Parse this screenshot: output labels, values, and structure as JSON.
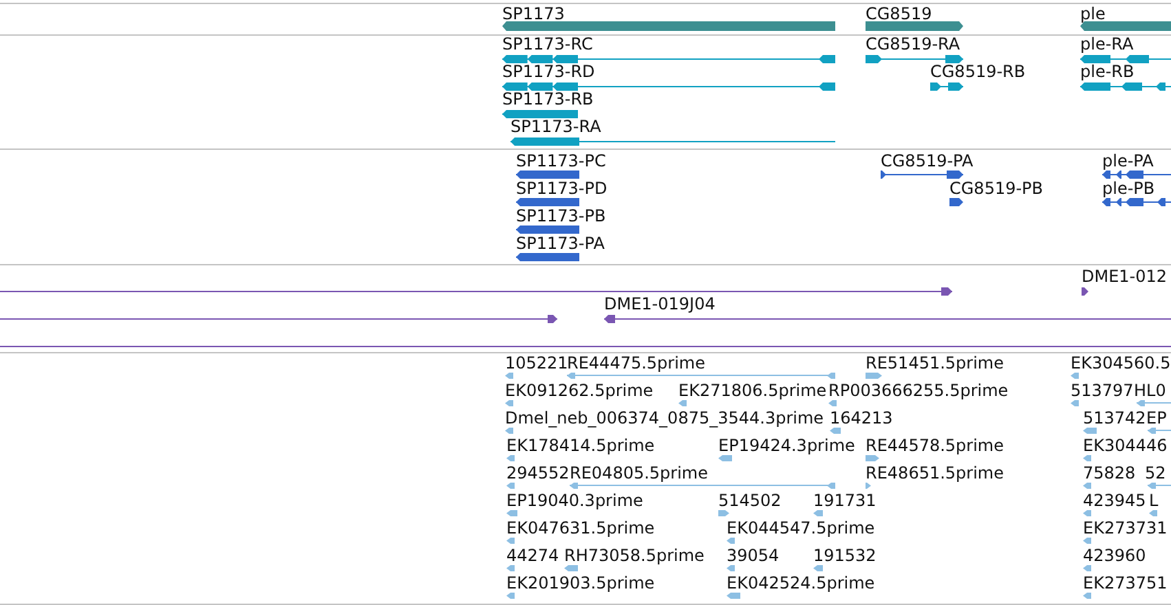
{
  "tracks": [
    {
      "kind": "gene",
      "features": [
        {
          "label": "SP1173",
          "reverse": true
        },
        {
          "label": "CG8519",
          "reverse": false
        },
        {
          "label": "ple",
          "reverse": true
        }
      ]
    },
    {
      "kind": "transcript",
      "features": [
        {
          "label": "SP1173-RC",
          "reverse": true
        },
        {
          "label": "SP1173-RD",
          "reverse": true
        },
        {
          "label": "SP1173-RB",
          "reverse": true
        },
        {
          "label": "SP1173-RA",
          "reverse": true
        },
        {
          "label": "CG8519-RA",
          "reverse": false
        },
        {
          "label": "CG8519-RB",
          "reverse": false
        },
        {
          "label": "ple-RA",
          "reverse": true
        },
        {
          "label": "ple-RB",
          "reverse": true
        }
      ]
    },
    {
      "kind": "protein",
      "features": [
        {
          "label": "SP1173-PC",
          "reverse": true
        },
        {
          "label": "SP1173-PD",
          "reverse": true
        },
        {
          "label": "SP1173-PB",
          "reverse": true
        },
        {
          "label": "SP1173-PA",
          "reverse": true
        },
        {
          "label": "CG8519-PA",
          "reverse": false
        },
        {
          "label": "CG8519-PB",
          "reverse": false
        },
        {
          "label": "ple-PA",
          "reverse": true
        },
        {
          "label": "ple-PB",
          "reverse": true
        }
      ]
    },
    {
      "kind": "clone",
      "features": [
        {
          "reverse": false
        },
        {
          "label": "DME1-012",
          "reverse": false
        },
        {
          "reverse": false
        },
        {
          "label": "DME1-019J04",
          "reverse": true
        }
      ]
    },
    {
      "kind": "est",
      "features": [
        {
          "label": "105221",
          "reverse": true
        },
        {
          "label": "RE44475.5prime",
          "reverse": true
        },
        {
          "label": "RE51451.5prime",
          "reverse": false
        },
        {
          "label": "EK304560.5",
          "reverse": true
        },
        {
          "label": "EK091262.5prime",
          "reverse": true
        },
        {
          "label": "EK271806.5prime",
          "reverse": true
        },
        {
          "label": "RP003666255.5prime",
          "reverse": true
        },
        {
          "label": "513797",
          "reverse": true
        },
        {
          "label": "HL0",
          "reverse": true
        },
        {
          "label": "Dmel_neb_006374_0875_3544.3prime",
          "reverse": true
        },
        {
          "label": "164213",
          "reverse": true
        },
        {
          "label": "513742",
          "reverse": true
        },
        {
          "label": "EP",
          "reverse": true
        },
        {
          "label": "EK178414.5prime",
          "reverse": true
        },
        {
          "label": "EP19424.3prime",
          "reverse": true
        },
        {
          "label": "RE44578.5prime",
          "reverse": false
        },
        {
          "label": "EK304446",
          "reverse": true
        },
        {
          "label": "294552",
          "reverse": true
        },
        {
          "label": "RE04805.5prime",
          "reverse": true
        },
        {
          "label": "RE48651.5prime",
          "reverse": false
        },
        {
          "label": "75828",
          "reverse": true
        },
        {
          "label": "52",
          "reverse": true
        },
        {
          "label": "EP19040.3prime",
          "reverse": true
        },
        {
          "label": "514502",
          "reverse": false
        },
        {
          "label": "191731",
          "reverse": true
        },
        {
          "label": "423945",
          "reverse": true
        },
        {
          "label": "L",
          "reverse": true
        },
        {
          "label": "EK047631.5prime",
          "reverse": true
        },
        {
          "label": "EK044547.5prime",
          "reverse": true
        },
        {
          "label": "EK273731",
          "reverse": true
        },
        {
          "label": "44274",
          "reverse": true
        },
        {
          "label": "RH73058.5prime",
          "reverse": true
        },
        {
          "label": "39054",
          "reverse": true
        },
        {
          "label": "191532",
          "reverse": true
        },
        {
          "label": "423960",
          "reverse": true
        },
        {
          "label": "EK201903.5prime",
          "reverse": true
        },
        {
          "label": "EK042524.5prime",
          "reverse": true
        },
        {
          "label": "EK273751",
          "reverse": true
        }
      ]
    }
  ]
}
